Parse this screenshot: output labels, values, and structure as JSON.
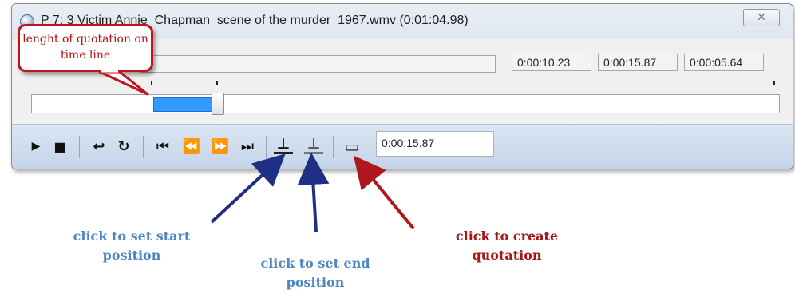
{
  "window": {
    "title": "P 7: 3 Victim Annie_Chapman_scene of the murder_1967.wmv (0:01:04.98)",
    "close_glyph": "✕"
  },
  "time_fields": {
    "start": "0:00:10.23",
    "end": "0:00:15.87",
    "length": "0:00:05.64"
  },
  "timeline": {
    "selection_fraction": {
      "start": 0.163,
      "end": 0.239
    }
  },
  "toolbar": {
    "play": "▶",
    "stop": "■",
    "return": "↩",
    "loop": "↻",
    "first": "⏮",
    "rewind": "⏪",
    "forward": "⏩",
    "last": "⏭",
    "set_start": "⊥",
    "set_end": "⊥",
    "create_quotation": "▭",
    "current_time": "0:00:15.87"
  },
  "annotations": {
    "callout": "lenght of quotation on time line",
    "set_start": "click to set start position",
    "set_end": "click to set end position",
    "create": "click to create quotation"
  },
  "colors": {
    "selection": "#3399ff",
    "callout_border": "#c0141c",
    "blue_arrow": "#1f2f86",
    "red_arrow": "#b0171c",
    "blue_text": "#4e86c4",
    "red_text": "#a51616"
  }
}
